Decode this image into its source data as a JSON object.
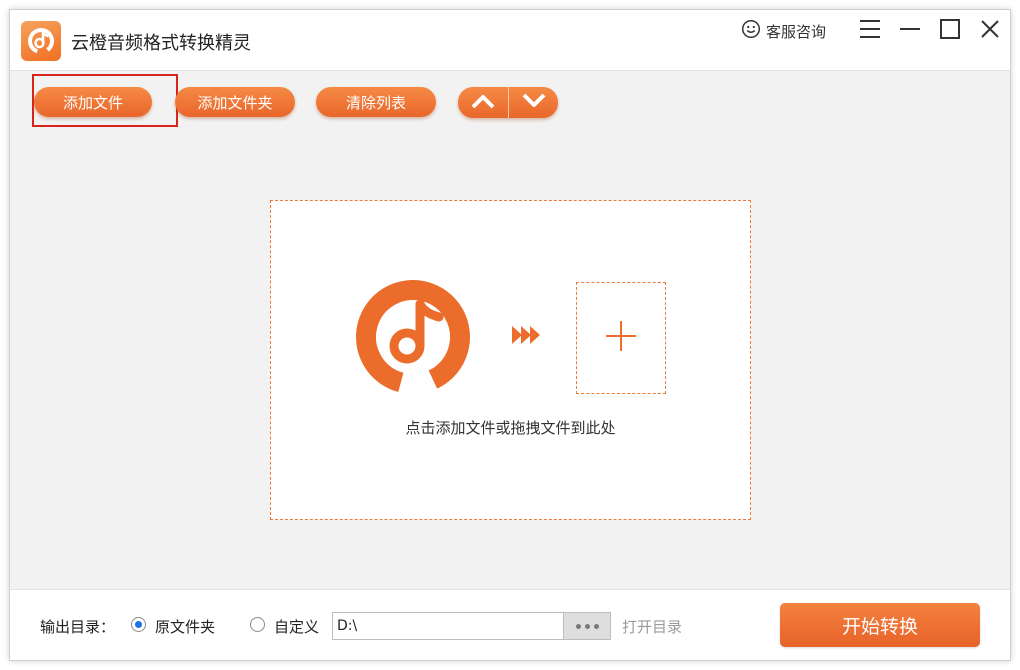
{
  "colors": {
    "accent": "#ec6c2b",
    "selection_frame": "#d9241b",
    "radio_checked": "#1a73e8"
  },
  "window": {
    "title": "云橙音频格式转换精灵",
    "support_label": "客服咨询",
    "icons": {
      "support": "smiley-icon",
      "menu": "hamburger-menu-icon",
      "minimize": "minimize-icon",
      "maximize": "maximize-icon",
      "close": "close-icon"
    }
  },
  "toolbar": {
    "add_file": "添加文件",
    "add_folder": "添加文件夹",
    "clear_list": "清除列表",
    "move_up_icon": "chevron-up-icon",
    "move_down_icon": "chevron-down-icon"
  },
  "dropzone": {
    "hint": "点击添加文件或拖拽文件到此处",
    "icons": [
      "app-music-logo-icon",
      "fast-forward-arrows-icon",
      "plus-icon"
    ]
  },
  "bottom": {
    "output_label": "输出目录：",
    "option_original": "原文件夹",
    "option_custom": "自定义",
    "selected_option": "原文件夹",
    "path_value": "D:\\",
    "open_dir": "打开目录",
    "start": "开始转换"
  }
}
